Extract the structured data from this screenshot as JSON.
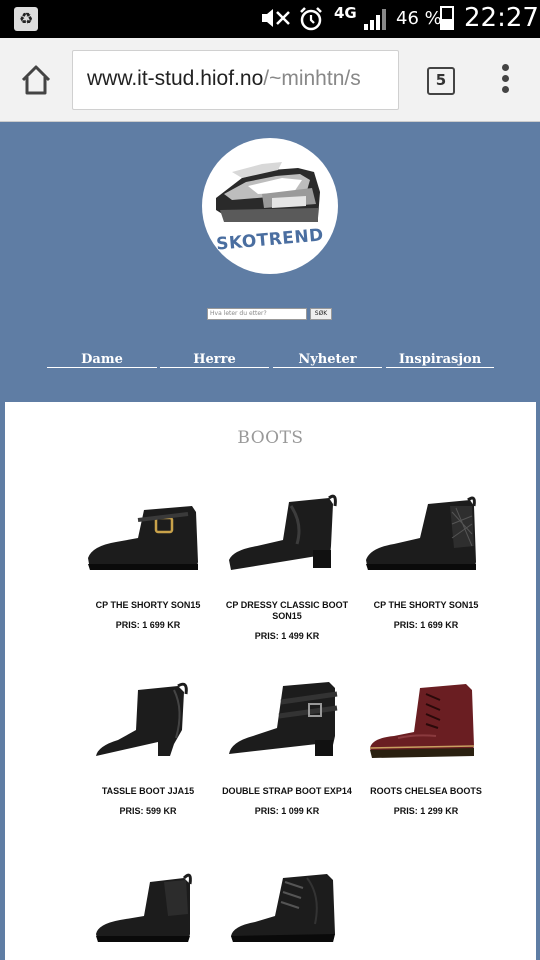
{
  "status_bar": {
    "network": "4G",
    "battery": "46 %",
    "time": "22:27",
    "battery_level": 0.46,
    "icons": [
      "recycle-icon",
      "mute-icon",
      "alarm-icon",
      "signal-icon",
      "battery-icon"
    ]
  },
  "browser": {
    "url_main": "www.it-stud.hiof.no",
    "url_rest": "/~minhtn/s",
    "tab_count": "5"
  },
  "site": {
    "logo_text": "SKOTREND",
    "search": {
      "placeholder": "Hva leter du etter?",
      "button": "SØK"
    },
    "nav": [
      "Dame",
      "Herre",
      "Nyheter",
      "Inspirasjon"
    ]
  },
  "section": {
    "title": "BOOTS"
  },
  "products": [
    {
      "name": "CP THE SHORTY SON15",
      "price": "PRIS: 1 699 KR"
    },
    {
      "name": "CP DRESSY CLASSIC BOOT SON15",
      "price": "PRIS: 1 499 KR"
    },
    {
      "name": "CP THE SHORTY SON15",
      "price": "PRIS: 1 699 KR"
    },
    {
      "name": "TASSLE BOOT JJA15",
      "price": "PRIS: 599 KR"
    },
    {
      "name": "DOUBLE STRAP BOOT EXP14",
      "price": "PRIS: 1 099 KR"
    },
    {
      "name": "ROOTS CHELSEA BOOTS",
      "price": "PRIS: 1 299 KR"
    },
    {
      "name": "",
      "price": ""
    },
    {
      "name": "",
      "price": ""
    }
  ],
  "colors": {
    "header_blue": "#5f7da4",
    "boot_black": "#1c1c1c",
    "boot_burgundy": "#6a1e22"
  }
}
